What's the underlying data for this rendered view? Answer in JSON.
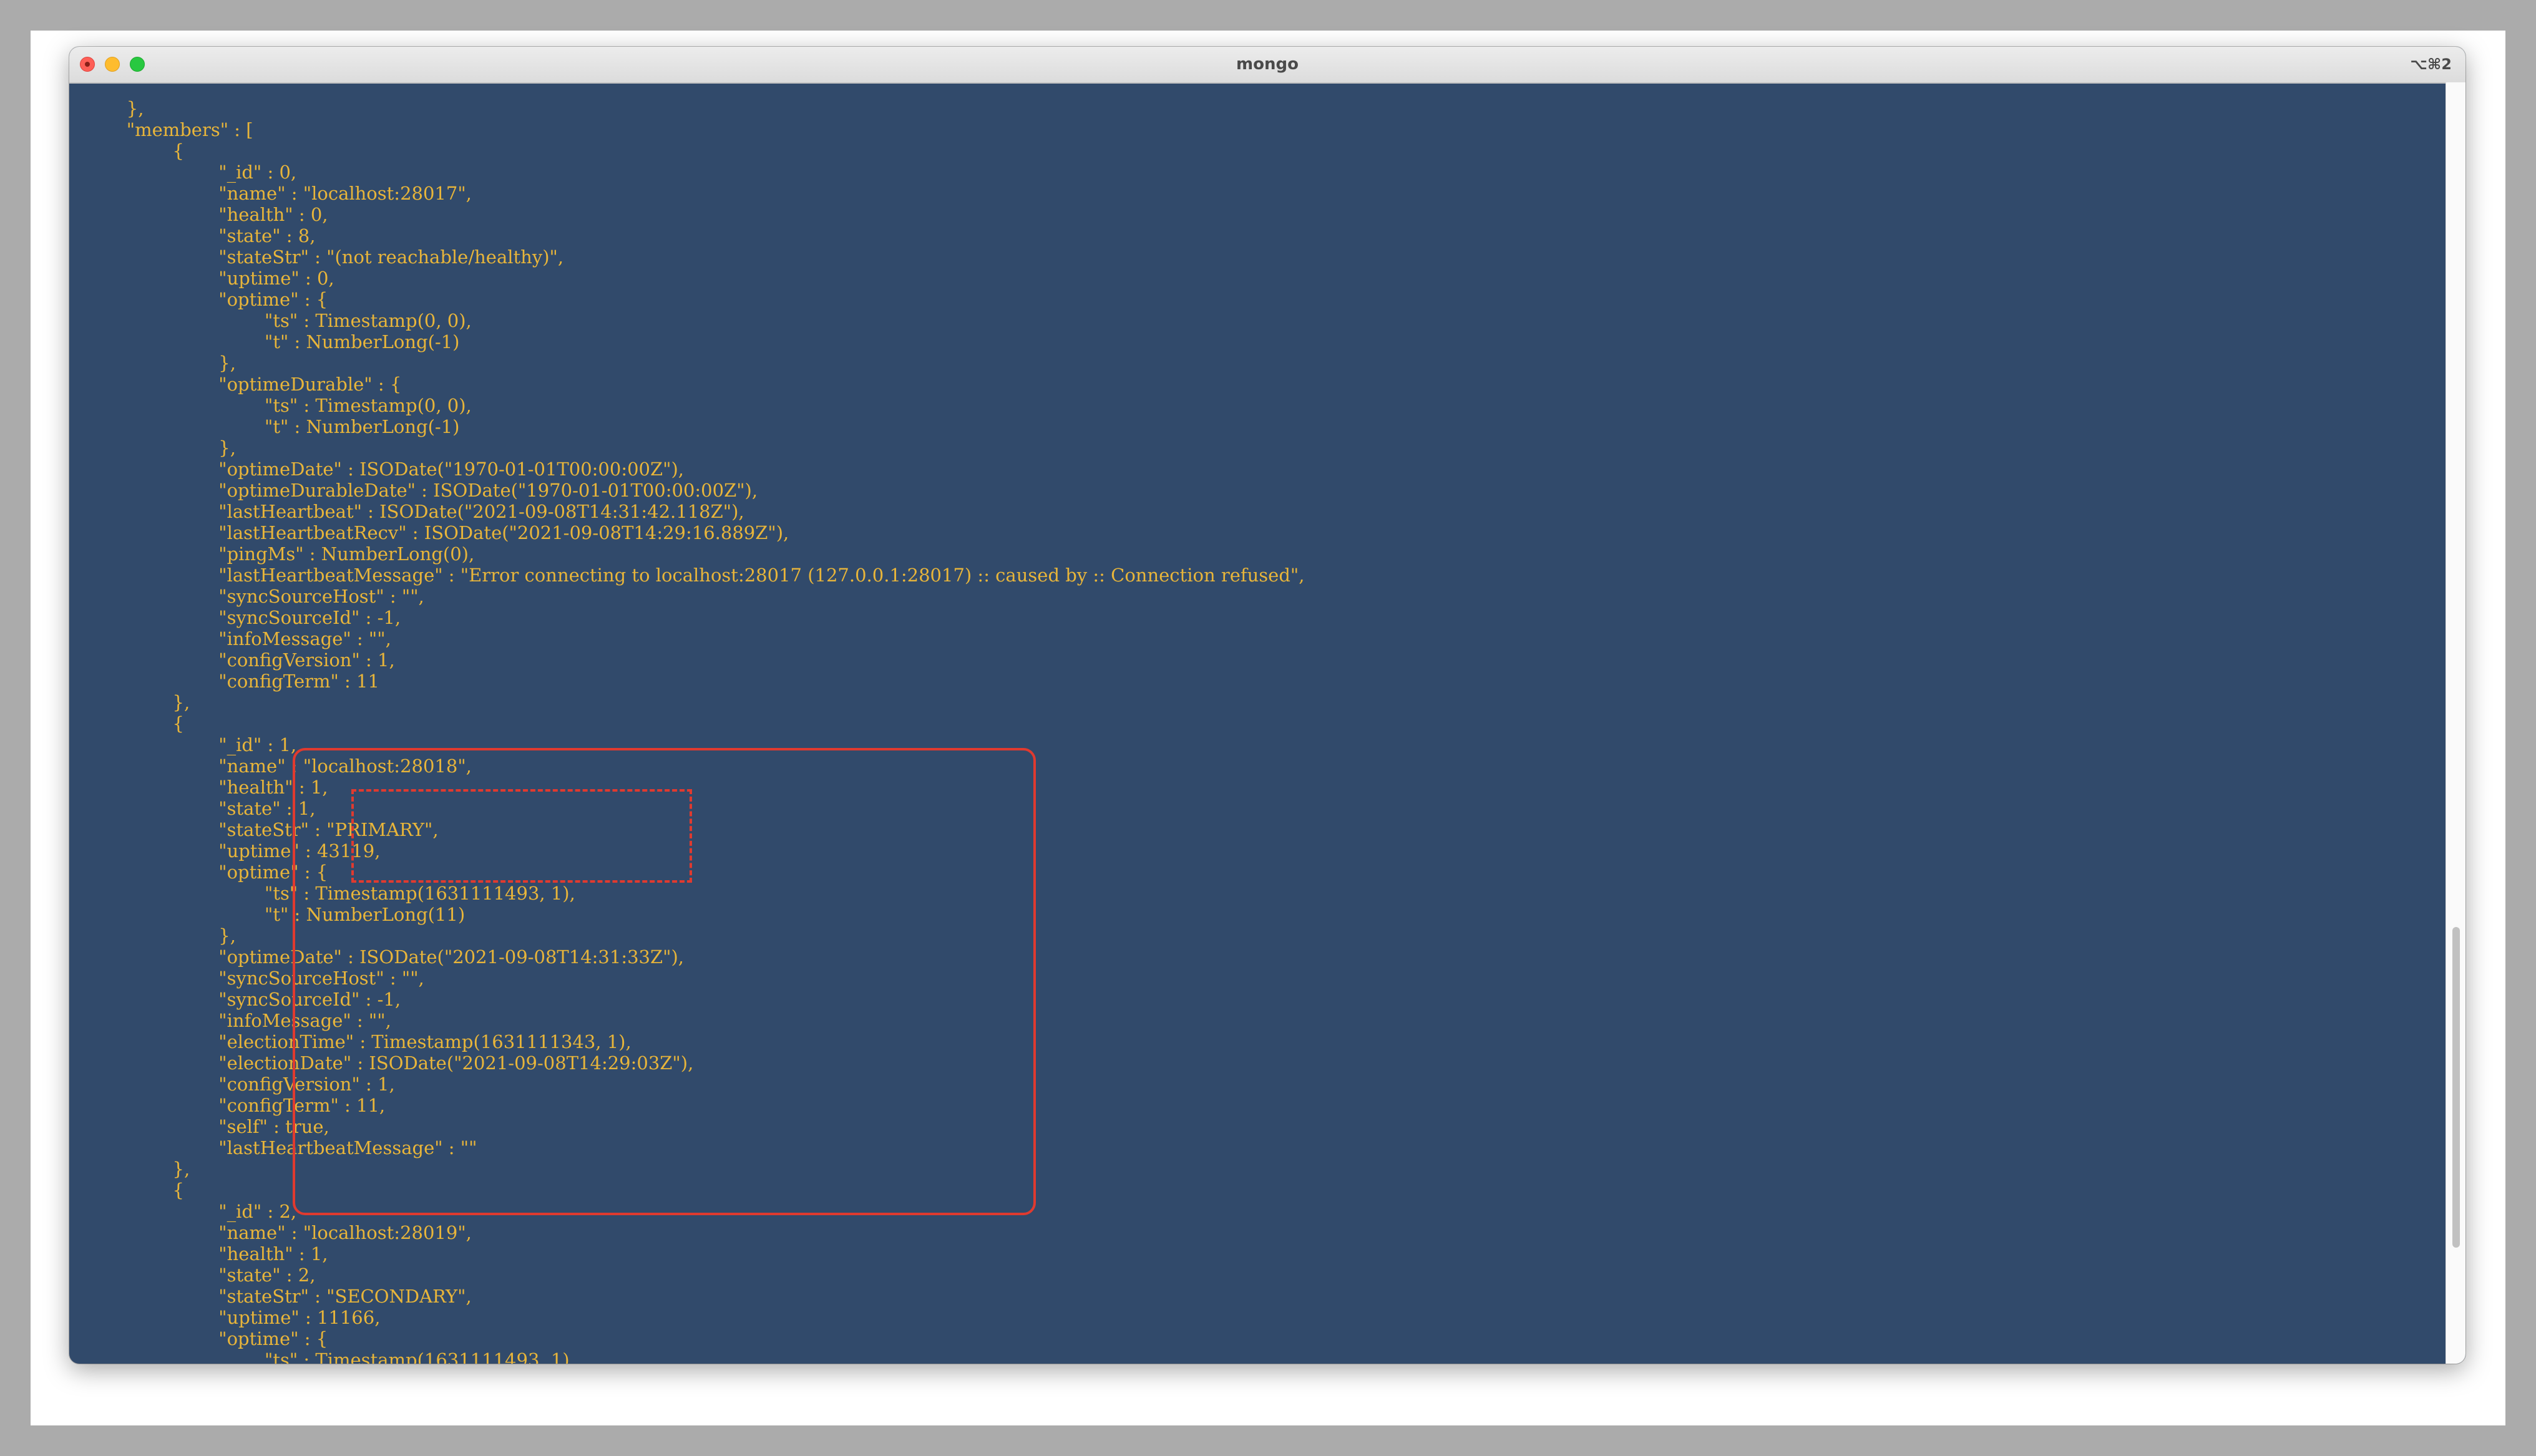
{
  "window": {
    "title": "mongo",
    "shortcut": "⌥⌘2"
  },
  "colors": {
    "terminal_background": "#314a6b",
    "terminal_text": "#e8b53a",
    "highlight": "#e03a2f"
  },
  "terminal": {
    "text": "        },\n        \"members\" : [\n                {\n                        \"_id\" : 0,\n                        \"name\" : \"localhost:28017\",\n                        \"health\" : 0,\n                        \"state\" : 8,\n                        \"stateStr\" : \"(not reachable/healthy)\",\n                        \"uptime\" : 0,\n                        \"optime\" : {\n                                \"ts\" : Timestamp(0, 0),\n                                \"t\" : NumberLong(-1)\n                        },\n                        \"optimeDurable\" : {\n                                \"ts\" : Timestamp(0, 0),\n                                \"t\" : NumberLong(-1)\n                        },\n                        \"optimeDate\" : ISODate(\"1970-01-01T00:00:00Z\"),\n                        \"optimeDurableDate\" : ISODate(\"1970-01-01T00:00:00Z\"),\n                        \"lastHeartbeat\" : ISODate(\"2021-09-08T14:31:42.118Z\"),\n                        \"lastHeartbeatRecv\" : ISODate(\"2021-09-08T14:29:16.889Z\"),\n                        \"pingMs\" : NumberLong(0),\n                        \"lastHeartbeatMessage\" : \"Error connecting to localhost:28017 (127.0.0.1:28017) :: caused by :: Connection refused\",\n                        \"syncSourceHost\" : \"\",\n                        \"syncSourceId\" : -1,\n                        \"infoMessage\" : \"\",\n                        \"configVersion\" : 1,\n                        \"configTerm\" : 11\n                },\n                {\n                        \"_id\" : 1,\n                        \"name\" : \"localhost:28018\",\n                        \"health\" : 1,\n                        \"state\" : 1,\n                        \"stateStr\" : \"PRIMARY\",\n                        \"uptime\" : 43119,\n                        \"optime\" : {\n                                \"ts\" : Timestamp(1631111493, 1),\n                                \"t\" : NumberLong(11)\n                        },\n                        \"optimeDate\" : ISODate(\"2021-09-08T14:31:33Z\"),\n                        \"syncSourceHost\" : \"\",\n                        \"syncSourceId\" : -1,\n                        \"infoMessage\" : \"\",\n                        \"electionTime\" : Timestamp(1631111343, 1),\n                        \"electionDate\" : ISODate(\"2021-09-08T14:29:03Z\"),\n                        \"configVersion\" : 1,\n                        \"configTerm\" : 11,\n                        \"self\" : true,\n                        \"lastHeartbeatMessage\" : \"\"\n                },\n                {\n                        \"_id\" : 2,\n                        \"name\" : \"localhost:28019\",\n                        \"health\" : 1,\n                        \"state\" : 2,\n                        \"stateStr\" : \"SECONDARY\",\n                        \"uptime\" : 11166,\n                        \"optime\" : {\n                                \"ts\" : Timestamp(1631111493, 1),"
  }
}
